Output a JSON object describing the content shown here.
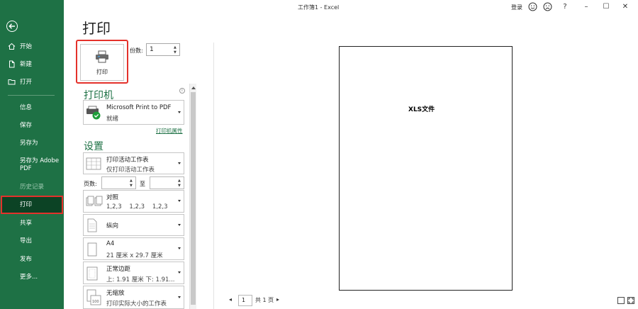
{
  "window": {
    "title": "工作簿1 - Excel",
    "login_label": "登录",
    "help_label": "?",
    "minimize_label": "–",
    "maximize_label": "☐",
    "close_label": "✕"
  },
  "sidebar": {
    "items": [
      {
        "label": "开始",
        "icon": "home-icon"
      },
      {
        "label": "新建",
        "icon": "new-file-icon"
      },
      {
        "label": "打开",
        "icon": "folder-icon"
      },
      {
        "label": "信息"
      },
      {
        "label": "保存"
      },
      {
        "label": "另存为"
      },
      {
        "label": "另存为 Adobe PDF"
      },
      {
        "label": "历史记录"
      },
      {
        "label": "打印"
      },
      {
        "label": "共享"
      },
      {
        "label": "导出"
      },
      {
        "label": "发布"
      },
      {
        "label": "更多..."
      }
    ],
    "save_as_pdf_line1": "另存为 Adobe",
    "save_as_pdf_line2": "PDF"
  },
  "print": {
    "title": "打印",
    "print_button_label": "打印",
    "copies_label": "份数:",
    "copies_value": "1"
  },
  "printer": {
    "heading": "打印机",
    "name": "Microsoft Print to PDF",
    "status": "就绪",
    "properties_link": "打印机属性"
  },
  "settings": {
    "heading": "设置",
    "scope": {
      "title": "打印活动工作表",
      "subtitle": "仅打印活动工作表"
    },
    "pages_label": "页数:",
    "to_label": "至",
    "collate": {
      "title": "对照",
      "subtitle": "1,2,3    1,2,3    1,2,3"
    },
    "orientation": {
      "title": "纵向"
    },
    "paper": {
      "title": "A4",
      "subtitle": "21 厘米 x 29.7 厘米"
    },
    "margins": {
      "title": "正常边距",
      "subtitle": "上: 1.91 厘米 下: 1.91..."
    },
    "scaling": {
      "title": "无缩放",
      "subtitle": "打印实际大小的工作表"
    }
  },
  "preview": {
    "page_text": "XLS文件",
    "current_page": "1",
    "total_pages": "共 1 页"
  },
  "colors": {
    "brand": "#1e7145",
    "highlight": "#e4312b"
  }
}
